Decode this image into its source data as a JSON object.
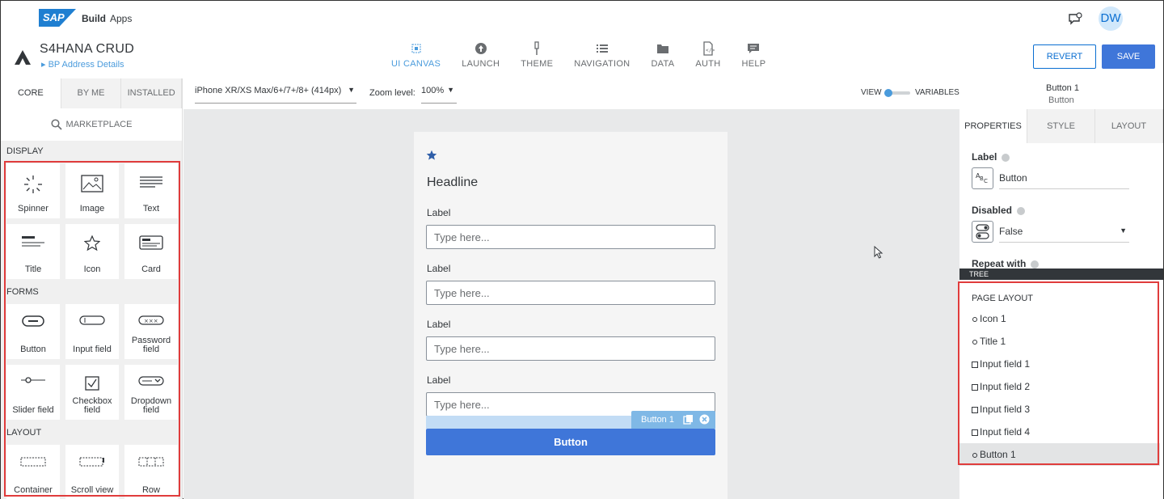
{
  "topbar": {
    "logo": "SAP",
    "brand_build": "Build",
    "brand_apps": "Apps",
    "avatar": "DW"
  },
  "project": {
    "title": "S4HANA CRUD",
    "page": "BP Address Details"
  },
  "nav": [
    {
      "label": "UI CANVAS",
      "icon": "canvas-icon",
      "active": true
    },
    {
      "label": "LAUNCH",
      "icon": "launch-icon"
    },
    {
      "label": "THEME",
      "icon": "theme-icon"
    },
    {
      "label": "NAVIGATION",
      "icon": "navigation-icon"
    },
    {
      "label": "DATA",
      "icon": "data-icon"
    },
    {
      "label": "AUTH",
      "icon": "auth-icon"
    },
    {
      "label": "HELP",
      "icon": "help-icon"
    }
  ],
  "actions": {
    "revert": "REVERT",
    "save": "SAVE"
  },
  "left_panel": {
    "tabs": [
      "CORE",
      "BY ME",
      "INSTALLED"
    ],
    "marketplace": "MARKETPLACE",
    "sections": {
      "display": {
        "label": "DISPLAY",
        "items": [
          "Spinner",
          "Image",
          "Text",
          "Title",
          "Icon",
          "Card"
        ]
      },
      "forms": {
        "label": "FORMS",
        "items": [
          "Button",
          "Input field",
          "Password field",
          "Slider field",
          "Checkbox field",
          "Dropdown field"
        ]
      },
      "layout": {
        "label": "LAYOUT",
        "items": [
          "Container",
          "Scroll view",
          "Row"
        ]
      }
    }
  },
  "toolbar": {
    "device": "iPhone XR/XS Max/6+/7+/8+ (414px)",
    "zoom_label": "Zoom level:",
    "zoom": "100%",
    "view": "VIEW",
    "variables": "VARIABLES",
    "selected_name": "Button 1",
    "selected_type": "Button"
  },
  "canvas": {
    "headline": "Headline",
    "field_label": "Label",
    "placeholder": "Type here...",
    "selection_tag": "Button 1",
    "button": "Button"
  },
  "right_panel": {
    "tabs": [
      "PROPERTIES",
      "STYLE",
      "LAYOUT"
    ],
    "label_title": "Label",
    "label_value": "Button",
    "disabled_title": "Disabled",
    "disabled_value": "False",
    "repeat_title": "Repeat with",
    "tree_bar": "TREE",
    "tree_heading": "PAGE LAYOUT",
    "tree": [
      "Icon 1",
      "Title 1",
      "Input field 1",
      "Input field 2",
      "Input field 3",
      "Input field 4",
      "Button 1"
    ]
  },
  "colors": {
    "accent": "#3f76d9",
    "link": "#4a9bdc",
    "highlight": "#e03c3c"
  }
}
